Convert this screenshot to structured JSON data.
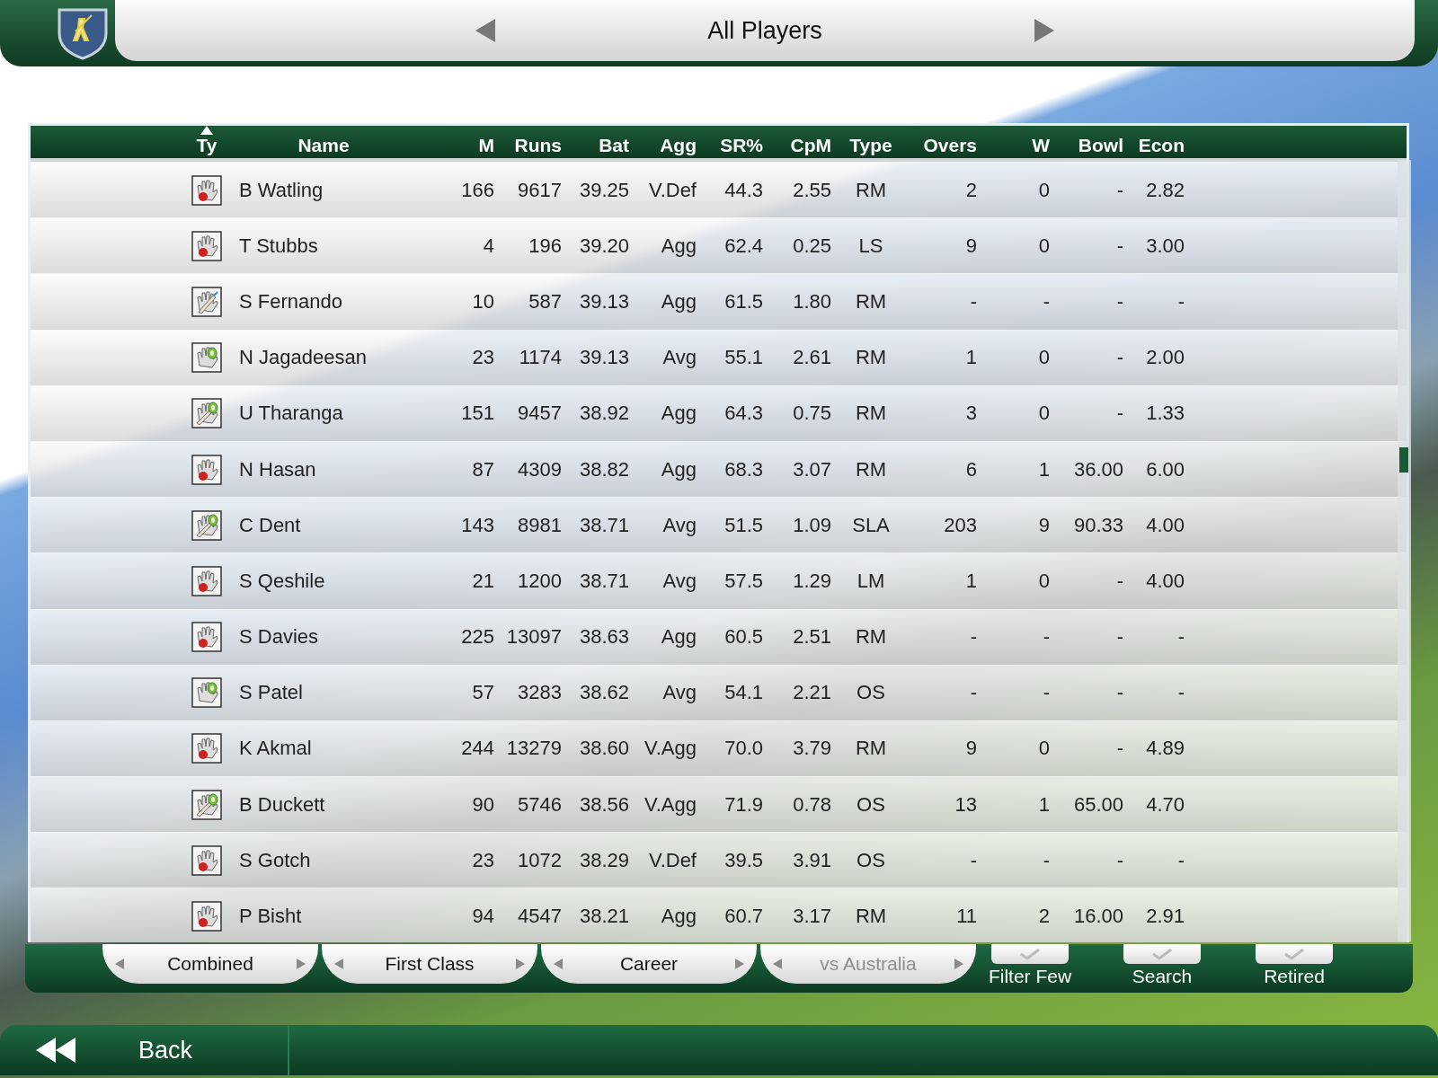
{
  "header": {
    "title": "All Players"
  },
  "table": {
    "columns": [
      {
        "label": "Ty",
        "sorted": true
      },
      {
        "label": "Name",
        "sorted": false
      },
      {
        "label": "M",
        "sorted": false
      },
      {
        "label": "Runs",
        "sorted": false
      },
      {
        "label": "Bat",
        "sorted": false
      },
      {
        "label": "Agg",
        "sorted": false
      },
      {
        "label": "SR%",
        "sorted": false
      },
      {
        "label": "CpM",
        "sorted": false
      },
      {
        "label": "Type",
        "sorted": false
      },
      {
        "label": "Overs",
        "sorted": false
      },
      {
        "label": "W",
        "sorted": false
      },
      {
        "label": "Bowl",
        "sorted": false
      },
      {
        "label": "Econ",
        "sorted": false
      }
    ],
    "rows": [
      {
        "kind": "bowler",
        "cells": [
          "",
          "B Watling",
          "166",
          "9617",
          "39.25",
          "V.Def",
          "44.3",
          "2.55",
          "RM",
          "2",
          "0",
          "-",
          "2.82"
        ]
      },
      {
        "kind": "bowler",
        "cells": [
          "",
          "T Stubbs",
          "4",
          "196",
          "39.20",
          "Agg",
          "62.4",
          "0.25",
          "LS",
          "9",
          "0",
          "-",
          "3.00"
        ]
      },
      {
        "kind": "batter",
        "cells": [
          "",
          "S Fernando",
          "10",
          "587",
          "39.13",
          "Agg",
          "61.5",
          "1.80",
          "RM",
          "-",
          "-",
          "-",
          "-"
        ]
      },
      {
        "kind": "keeper",
        "cells": [
          "",
          "N Jagadeesan",
          "23",
          "1174",
          "39.13",
          "Avg",
          "55.1",
          "2.61",
          "RM",
          "1",
          "0",
          "-",
          "2.00"
        ]
      },
      {
        "kind": "keeperbatter",
        "cells": [
          "",
          "U Tharanga",
          "151",
          "9457",
          "38.92",
          "Agg",
          "64.3",
          "0.75",
          "RM",
          "3",
          "0",
          "-",
          "1.33"
        ]
      },
      {
        "kind": "bowler",
        "cells": [
          "",
          "N Hasan",
          "87",
          "4309",
          "38.82",
          "Agg",
          "68.3",
          "3.07",
          "RM",
          "6",
          "1",
          "36.00",
          "6.00"
        ]
      },
      {
        "kind": "keeperbatter",
        "cells": [
          "",
          "C Dent",
          "143",
          "8981",
          "38.71",
          "Avg",
          "51.5",
          "1.09",
          "SLA",
          "203",
          "9",
          "90.33",
          "4.00"
        ]
      },
      {
        "kind": "bowler",
        "cells": [
          "",
          "S Qeshile",
          "21",
          "1200",
          "38.71",
          "Avg",
          "57.5",
          "1.29",
          "LM",
          "1",
          "0",
          "-",
          "4.00"
        ]
      },
      {
        "kind": "bowler",
        "cells": [
          "",
          "S Davies",
          "225",
          "13097",
          "38.63",
          "Agg",
          "60.5",
          "2.51",
          "RM",
          "-",
          "-",
          "-",
          "-"
        ]
      },
      {
        "kind": "keeper",
        "cells": [
          "",
          "S Patel",
          "57",
          "3283",
          "38.62",
          "Avg",
          "54.1",
          "2.21",
          "OS",
          "-",
          "-",
          "-",
          "-"
        ]
      },
      {
        "kind": "bowler",
        "cells": [
          "",
          "K Akmal",
          "244",
          "13279",
          "38.60",
          "V.Agg",
          "70.0",
          "3.79",
          "RM",
          "9",
          "0",
          "-",
          "4.89"
        ]
      },
      {
        "kind": "keeperbatter",
        "cells": [
          "",
          "B Duckett",
          "90",
          "5746",
          "38.56",
          "V.Agg",
          "71.9",
          "0.78",
          "OS",
          "13",
          "1",
          "65.00",
          "4.70"
        ]
      },
      {
        "kind": "bowler",
        "cells": [
          "",
          "S Gotch",
          "23",
          "1072",
          "38.29",
          "V.Def",
          "39.5",
          "3.91",
          "OS",
          "-",
          "-",
          "-",
          "-"
        ]
      },
      {
        "kind": "bowler",
        "cells": [
          "",
          "P Bisht",
          "94",
          "4547",
          "38.21",
          "Agg",
          "60.7",
          "3.17",
          "RM",
          "11",
          "2",
          "16.00",
          "2.91"
        ]
      }
    ]
  },
  "filters": {
    "tabs": [
      {
        "label": "Combined",
        "disabled": false
      },
      {
        "label": "First Class",
        "disabled": false
      },
      {
        "label": "Career",
        "disabled": false
      },
      {
        "label": "vs Australia",
        "disabled": true
      }
    ],
    "toggles": [
      {
        "label": "Filter Few",
        "checked": false
      },
      {
        "label": "Search",
        "checked": false
      },
      {
        "label": "Retired",
        "checked": false
      }
    ]
  },
  "footer": {
    "back": "Back"
  }
}
